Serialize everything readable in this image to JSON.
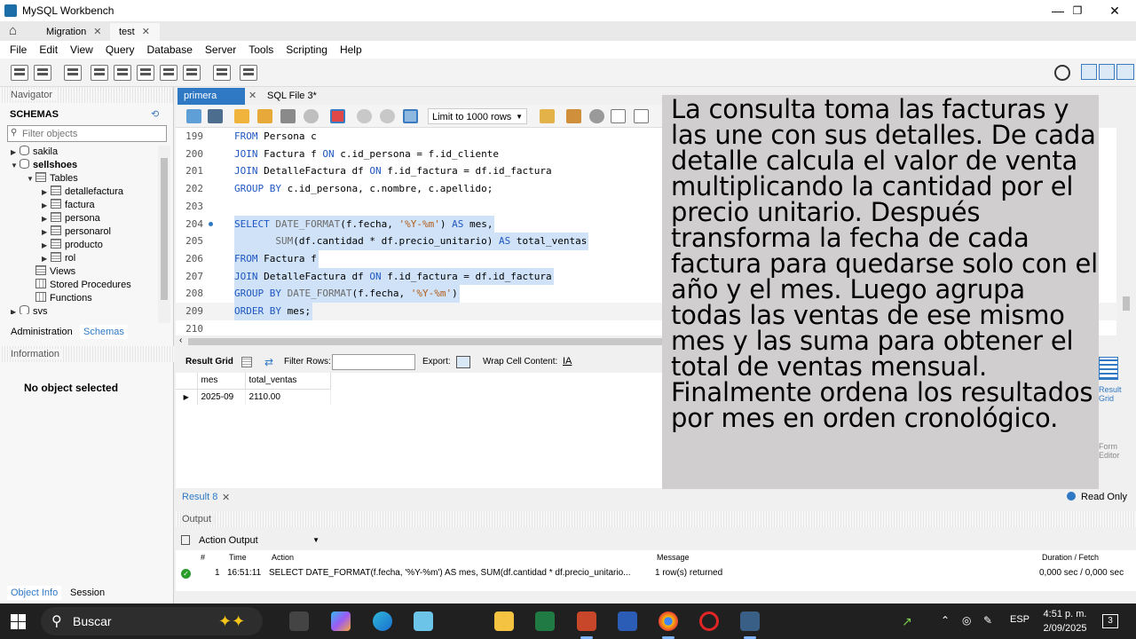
{
  "window": {
    "title": "MySQL Workbench",
    "controls": {
      "minimize": "—",
      "maximize": "❐",
      "close": "✕"
    }
  },
  "connection_tabs": [
    {
      "label": "Migration"
    },
    {
      "label": "test"
    }
  ],
  "menu": [
    "File",
    "Edit",
    "View",
    "Query",
    "Database",
    "Server",
    "Tools",
    "Scripting",
    "Help"
  ],
  "navigator": {
    "header": "Navigator",
    "schemas_label": "SCHEMAS",
    "filter_placeholder": "Filter objects",
    "tree": [
      {
        "label": "sakila"
      },
      {
        "label": "sellshoes"
      },
      {
        "label": "Tables"
      },
      {
        "label": "detallefactura"
      },
      {
        "label": "factura"
      },
      {
        "label": "persona"
      },
      {
        "label": "personarol"
      },
      {
        "label": "producto"
      },
      {
        "label": "rol"
      },
      {
        "label": "Views"
      },
      {
        "label": "Stored Procedures"
      },
      {
        "label": "Functions"
      },
      {
        "label": "sys"
      }
    ],
    "tabs": [
      "Administration",
      "Schemas"
    ],
    "info_header": "Information",
    "no_object": "No object selected",
    "bottom_tabs": [
      "Object Info",
      "Session"
    ]
  },
  "editor": {
    "tabs": [
      "primera parte*",
      "SQL File 3*"
    ],
    "limit": "Limit to 1000 rows",
    "lines": [
      {
        "n": "199",
        "text": "FROM Persona c"
      },
      {
        "n": "200",
        "text": "JOIN Factura f ON c.id_persona = f.id_cliente"
      },
      {
        "n": "201",
        "text": "JOIN DetalleFactura df ON f.id_factura = df.id_factura"
      },
      {
        "n": "202",
        "text": "GROUP BY c.id_persona, c.nombre, c.apellido;"
      },
      {
        "n": "203",
        "text": ""
      },
      {
        "n": "204",
        "text": "SELECT DATE_FORMAT(f.fecha, '%Y-%m') AS mes,"
      },
      {
        "n": "205",
        "text": "       SUM(df.cantidad * df.precio_unitario) AS total_ventas"
      },
      {
        "n": "206",
        "text": "FROM Factura f"
      },
      {
        "n": "207",
        "text": "JOIN DetalleFactura df ON f.id_factura = df.id_factura"
      },
      {
        "n": "208",
        "text": "GROUP BY DATE_FORMAT(f.fecha, '%Y-%m')"
      },
      {
        "n": "209",
        "text": "ORDER BY mes;"
      },
      {
        "n": "210",
        "text": ""
      }
    ]
  },
  "result_toolbar": {
    "result_grid": "Result Grid",
    "filter_rows": "Filter Rows:",
    "export": "Export:",
    "wrap": "Wrap Cell Content:"
  },
  "result_grid": {
    "columns": [
      "mes",
      "total_ventas"
    ],
    "rows": [
      [
        "2025-09",
        "2110.00"
      ]
    ]
  },
  "side_panel": {
    "result_grid": [
      "Result",
      "Grid"
    ],
    "form_editor": [
      "Form",
      "Editor"
    ]
  },
  "annotation": "La consulta toma las facturas y las une con sus detalles. De cada detalle calcula el valor de venta multiplicando la cantidad por el precio unitario. Después transforma la fecha de cada factura para quedarse solo con el año y el mes. Luego agrupa todas las ventas de ese mismo mes y las suma para obtener el total de ventas mensual. Finalmente ordena los resultados por mes en orden cronológico.",
  "result_tabs": {
    "label": "Result 8",
    "read_only": "Read Only"
  },
  "output": {
    "header": "Output",
    "mode": "Action Output",
    "columns": [
      "#",
      "Time",
      "Action",
      "Message",
      "Duration / Fetch"
    ],
    "row": {
      "num": "1",
      "time": "16:51:11",
      "action": "SELECT DATE_FORMAT(f.fecha, '%Y-%m') AS mes,        SUM(df.cantidad * df.precio_unitario...",
      "message": "1 row(s) returned",
      "duration": "0,000 sec / 0,000 sec"
    }
  },
  "taskbar": {
    "search": "Buscar",
    "lang": "ESP",
    "time": "4:51 p. m.",
    "date": "2/09/2025",
    "notifications": "3"
  }
}
